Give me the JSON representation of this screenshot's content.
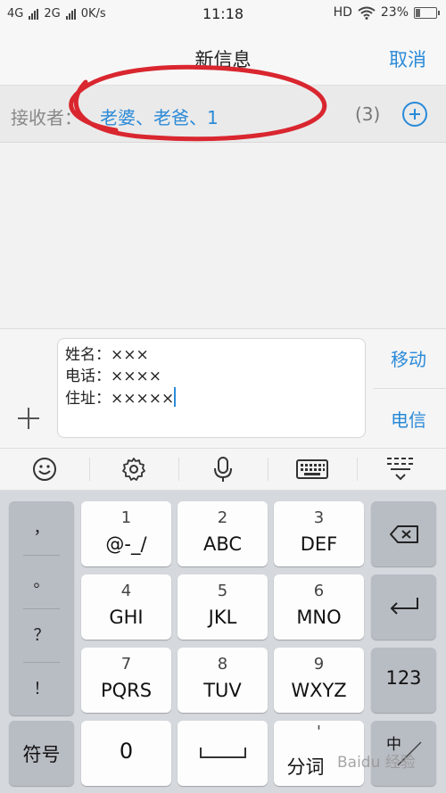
{
  "status_bar": {
    "network_1": "4G",
    "network_2": "2G",
    "speed": "0K/s",
    "time": "11:18",
    "hd": "HD",
    "battery": "23%",
    "battery_level": 0.23
  },
  "nav": {
    "title": "新信息",
    "cancel": "取消"
  },
  "recipient": {
    "label": "接收者：",
    "names": "老婆、老爸、1",
    "count": "(3)"
  },
  "composer": {
    "lines": [
      "姓名：×××",
      "电话：××××",
      "住址：×××××"
    ],
    "sim_1": "移动",
    "sim_2": "电信"
  },
  "toolbar": {
    "icons": [
      "emoji-icon",
      "settings-icon",
      "microphone-icon",
      "keyboard-icon",
      "collapse-keyboard-icon"
    ]
  },
  "keyboard": {
    "punctuation": [
      "，",
      "。",
      "？",
      "！"
    ],
    "keys": [
      {
        "num": "1",
        "letters": "@-_/"
      },
      {
        "num": "2",
        "letters": "ABC"
      },
      {
        "num": "3",
        "letters": "DEF"
      },
      {
        "num": "4",
        "letters": "GHI"
      },
      {
        "num": "5",
        "letters": "JKL"
      },
      {
        "num": "6",
        "letters": "MNO"
      },
      {
        "num": "7",
        "letters": "PQRS"
      },
      {
        "num": "8",
        "letters": "TUV"
      },
      {
        "num": "9",
        "letters": "WXYZ"
      }
    ],
    "numeric_key": "123",
    "symbols_key": "符号",
    "zero_key": "0",
    "split_key_top": "'",
    "split_key": "分词",
    "lang_key": "中"
  },
  "watermark": "Baidu 经验",
  "colors": {
    "accent": "#2a8ad8",
    "annotation": "#d9262f"
  }
}
